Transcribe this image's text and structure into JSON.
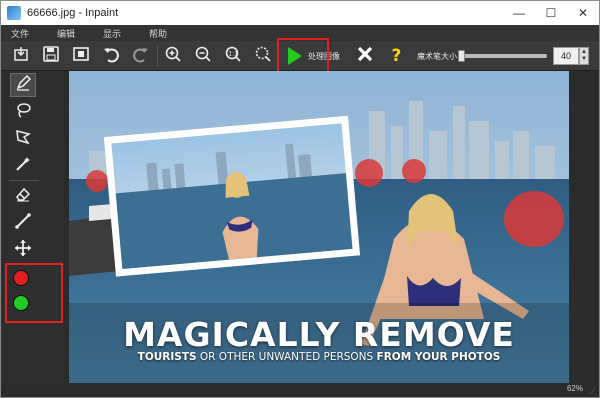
{
  "window": {
    "title": "66666.jpg - Inpaint",
    "controls": {
      "minimize": "—",
      "maximize": "☐",
      "close": "✕"
    }
  },
  "menu": {
    "items": [
      "文件",
      "编辑",
      "显示",
      "帮助"
    ]
  },
  "toolbar": {
    "process_label": "处理图像",
    "marker_size_label": "魔术笔大小",
    "marker_size_value": "40",
    "marker_size_fraction": 0.0
  },
  "icons": {
    "open": "open-icon",
    "save": "save-icon",
    "save_as": "save-as-icon",
    "undo": "undo-icon",
    "redo": "redo-icon",
    "zoom_in": "zoom-in-icon",
    "zoom_out": "zoom-out-icon",
    "actual_size": "actual-size-icon",
    "fit": "fit-window-icon",
    "play": "play-icon",
    "cancel": "cancel-icon",
    "help": "help-icon"
  },
  "tools": [
    "marker-icon",
    "lasso-icon",
    "polygon-lasso-icon",
    "magic-wand-icon",
    "eraser-icon",
    "line-icon",
    "move-icon"
  ],
  "colors": {
    "remove": "#e02020",
    "keep": "#22cc22",
    "process_play": "#22cc22",
    "help": "#ffd400",
    "highlight": "#e02020"
  },
  "canvas": {
    "headline": "MAGICALLY REMOVE",
    "sub_part1": "TOURISTS",
    "sub_part2": " OR OTHER UNWANTED PERSONS ",
    "sub_part3": "FROM YOUR PHOTOS"
  },
  "status": {
    "zoom": "62%"
  }
}
